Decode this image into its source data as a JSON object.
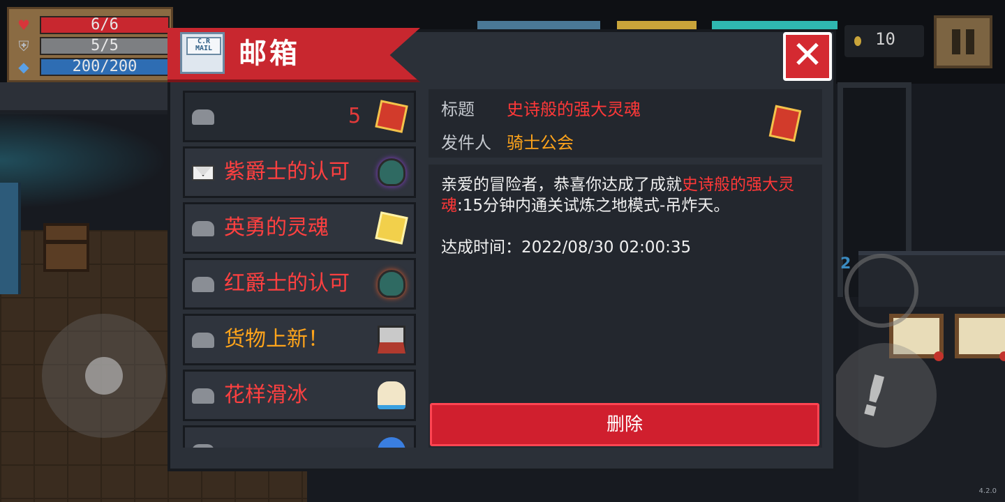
{
  "hud": {
    "health": {
      "text": "6/6",
      "fraction": 1.0,
      "icon": "heart-icon",
      "color": "#c8272f"
    },
    "armor": {
      "text": "5/5",
      "fraction": 1.0,
      "icon": "shield-icon",
      "color": "#7d7f82"
    },
    "energy": {
      "text": "200/200",
      "fraction": 1.0,
      "icon": "gem-icon",
      "color": "#2e6db3"
    }
  },
  "coins": {
    "count": "10",
    "icon": "coin-icon"
  },
  "mailbox": {
    "title": "邮箱",
    "title_icon_text": "C.R MAIL",
    "close_icon": "close-icon",
    "items": [
      {
        "title": "",
        "count": "5",
        "icon": "epic-soul-book-icon",
        "state": "read",
        "title_color": "#ff4040"
      },
      {
        "title": "紫爵士的认可",
        "icon": "purple-knight-helmet-icon",
        "state": "unread",
        "title_color": "#ff4040"
      },
      {
        "title": "英勇的灵魂",
        "icon": "brave-soul-book-icon",
        "state": "read",
        "title_color": "#ff4040"
      },
      {
        "title": "红爵士的认可",
        "icon": "red-knight-helmet-icon",
        "state": "read",
        "title_color": "#ff4040"
      },
      {
        "title": "货物上新！",
        "icon": "merchant-cat-icon",
        "state": "read",
        "title_color": "#ffa41b"
      },
      {
        "title": "花样滑冰",
        "icon": "figure-skate-icon",
        "state": "read",
        "title_color": "#ff4040"
      },
      {
        "title": "",
        "icon": "partial-item-icon",
        "state": "read",
        "title_color": "#ff4040"
      }
    ],
    "detail": {
      "subject_label": "标题",
      "subject": "史诗般的强大灵魂",
      "sender_label": "发件人",
      "sender": "骑士公会",
      "body_prefix": "亲爱的冒险者，恭喜你达成了成就",
      "body_highlight": "史诗般的强大灵魂",
      "body_suffix": ":15分钟内通关试炼之地模式-吊炸天。",
      "time_label": "达成时间：",
      "time_value": "2022/08/30 02:00:35"
    },
    "delete_label": "删除"
  },
  "skill": {
    "count": "2"
  },
  "version": "4.2.0"
}
